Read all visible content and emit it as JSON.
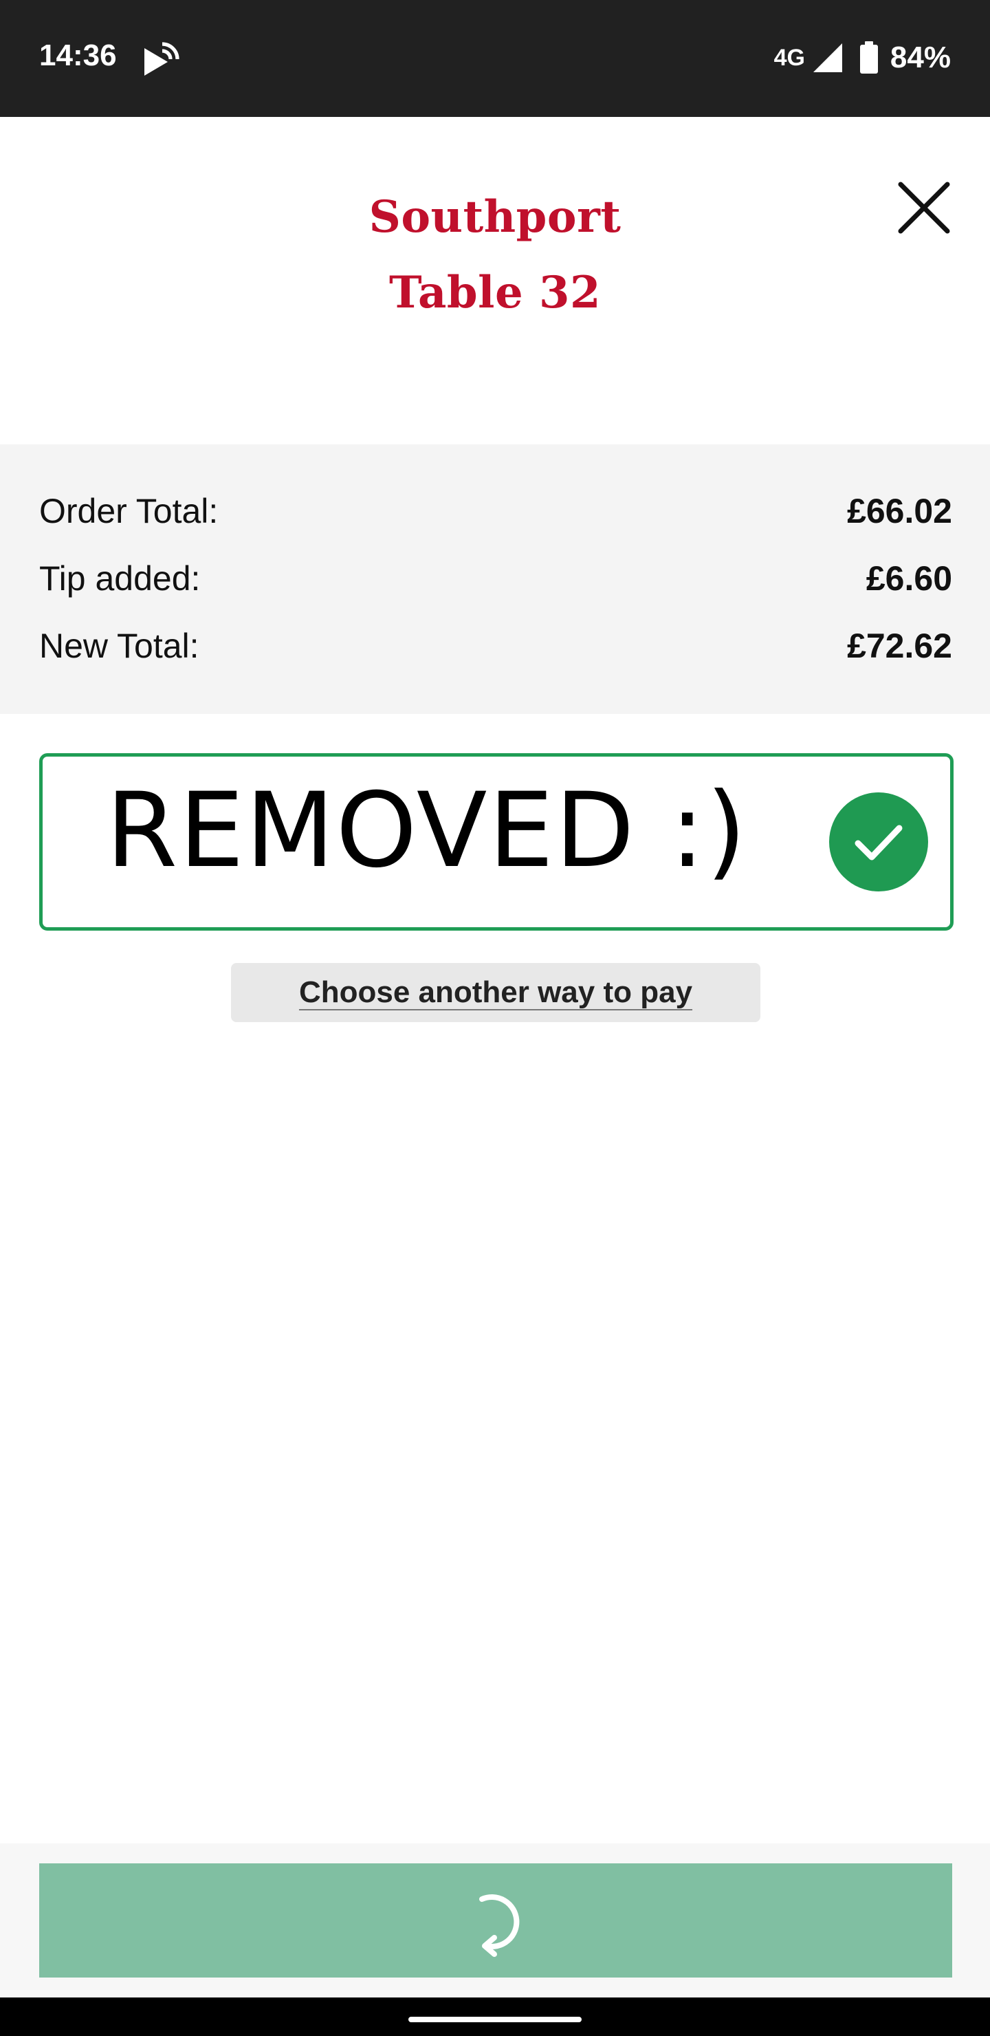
{
  "status_bar": {
    "time": "14:36",
    "network": "4G",
    "battery": "84%",
    "icons": [
      "cast-icon",
      "signal-icon",
      "battery-icon"
    ]
  },
  "header": {
    "venue": "Southport",
    "table": "Table 32",
    "close_icon": "close-icon",
    "title_color": "#c0102c"
  },
  "summary": {
    "order_total_label": "Order Total:",
    "order_total_value": "£66.02",
    "tip_label": "Tip added:",
    "tip_value": "£6.60",
    "new_total_label": "New Total:",
    "new_total_value": "£72.62"
  },
  "payment_method": {
    "text": "REMOVED :)",
    "selected_icon": "check-circle-icon",
    "accent": "#1f9d55"
  },
  "alt_pay": {
    "label": "Choose another way to pay"
  },
  "pay_button": {
    "icon": "loading-spinner-icon",
    "color": "#80bfa2"
  }
}
